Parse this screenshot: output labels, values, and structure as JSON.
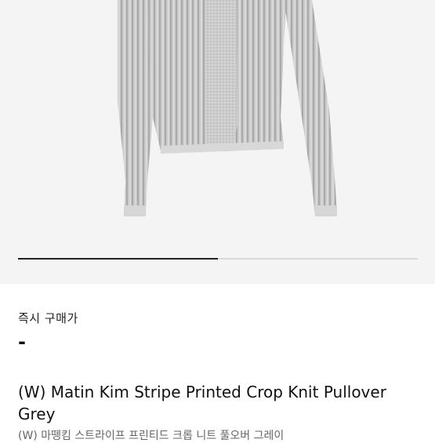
{
  "product": {
    "image_alt": "grey ribbed crop knit pullover",
    "gallery_progress": 0.5,
    "instant_buy_label": "즉시 구매가",
    "instant_buy_price": "-",
    "title": "(W) Matin Kim Stripe Printed Crop Knit Pullover Grey",
    "subtitle_ko": "(W) 마뗑킴 스트라이프 프린티드 크롭 니트 풀오버 그레이"
  },
  "colors": {
    "gallery_bg": "#f4f4f4",
    "knit": "#c7c7c7",
    "knit_dark": "#a9a9a9",
    "knit_light": "#dcdcdc",
    "progress": "#222222"
  }
}
